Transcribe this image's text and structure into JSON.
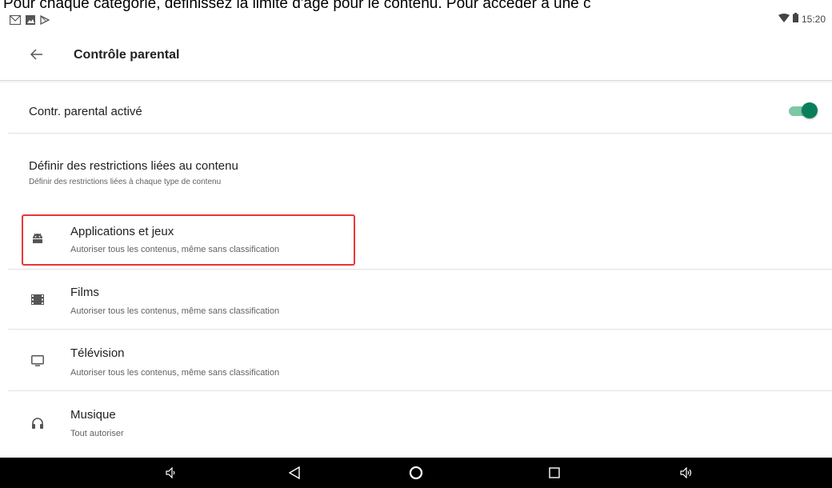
{
  "caption": "Pour chaque catégorie, définissez la limite d'âge pour le contenu. Pour accéder à une c",
  "status_bar": {
    "left_icons": [
      "gmail-icon",
      "image-icon",
      "play-store-icon"
    ],
    "time": "15:20",
    "right_icons": [
      "wifi-icon",
      "battery-icon"
    ]
  },
  "header": {
    "title": "Contrôle parental",
    "back_icon": "arrow-left-icon"
  },
  "parental_toggle": {
    "label": "Contr. parental activé",
    "enabled": true,
    "color_thumb": "#0a7e5a",
    "color_track": "#7cc8a4"
  },
  "restrictions": {
    "title": "Définir des restrictions liées au contenu",
    "subtitle": "Définir des restrictions liées à chaque type de contenu"
  },
  "categories": [
    {
      "title": "Applications et jeux",
      "subtitle": "Autoriser tous les contenus, même sans classification",
      "icon": "android-icon"
    },
    {
      "title": "Films",
      "subtitle": "Autoriser tous les contenus, même sans classification",
      "icon": "film-icon"
    },
    {
      "title": "Télévision",
      "subtitle": "Autoriser tous les contenus, même sans classification",
      "icon": "tv-icon"
    },
    {
      "title": "Musique",
      "subtitle": "Tout autoriser",
      "icon": "headphones-icon"
    }
  ],
  "highlight_color": "#e53935",
  "nav_bar": [
    "volume-down-icon",
    "back-triangle-icon",
    "home-circle-icon",
    "recents-square-icon",
    "volume-up-icon"
  ]
}
